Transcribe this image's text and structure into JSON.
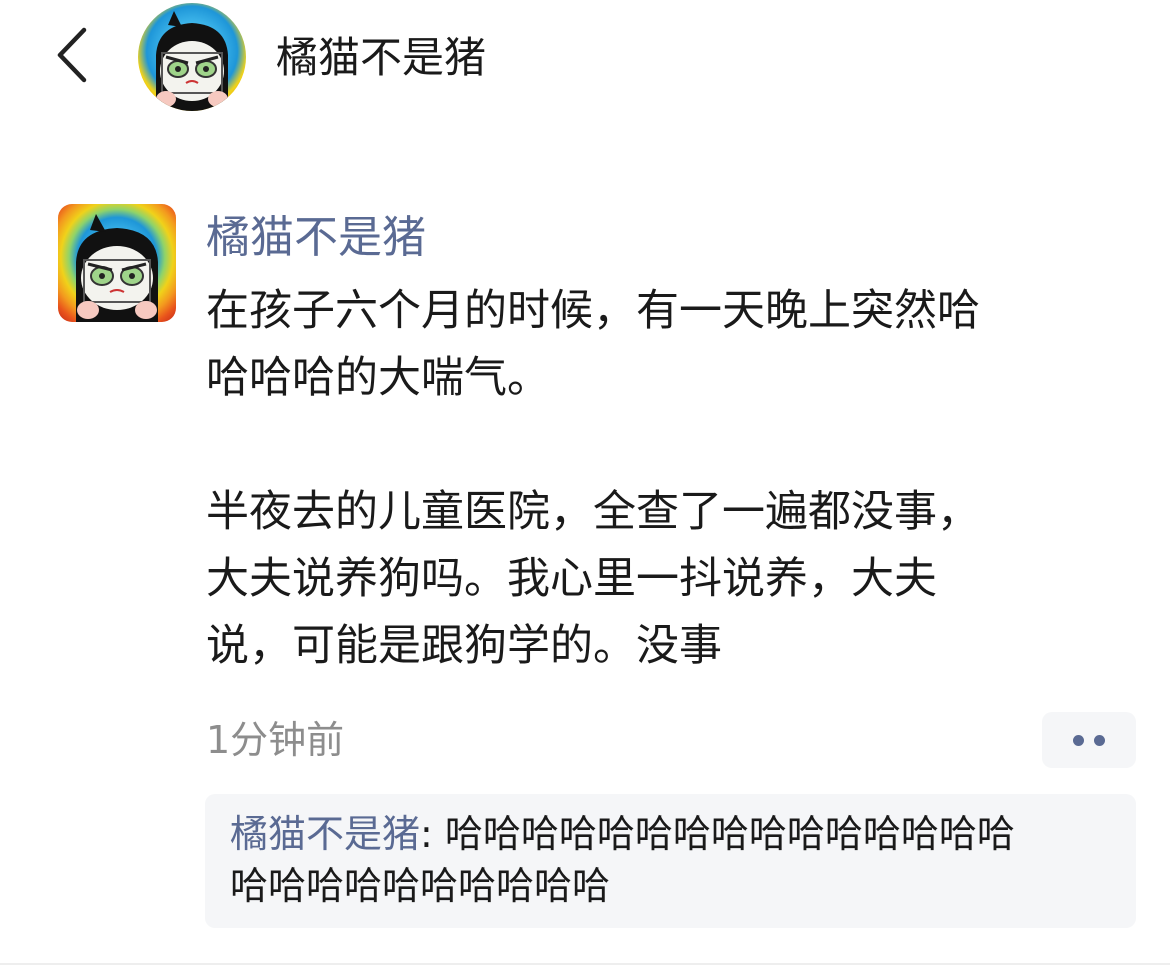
{
  "header": {
    "title": "橘猫不是猪"
  },
  "post": {
    "author": "橘猫不是猪",
    "body_lines": [
      "在孩子六个月的时候，有一天晚上突然哈",
      "哈哈哈的大喘气。",
      "",
      "半夜去的儿童医院，全查了一遍都没事，",
      "大夫说养狗吗。我心里一抖说养，大夫",
      "说，可能是跟狗学的。没事"
    ],
    "timestamp": "1分钟前"
  },
  "comment": {
    "author": "橘猫不是猪",
    "separator": ": ",
    "text_line1": "哈哈哈哈哈哈哈哈哈哈哈哈哈哈哈",
    "text_line2": "哈哈哈哈哈哈哈哈哈哈"
  },
  "colors": {
    "author_link": "#5a6a93",
    "comment_bg": "#f5f6f8",
    "timestamp": "#8d8d8d"
  },
  "icons": {
    "back": "chevron-left-icon",
    "more": "more-dots-icon"
  }
}
